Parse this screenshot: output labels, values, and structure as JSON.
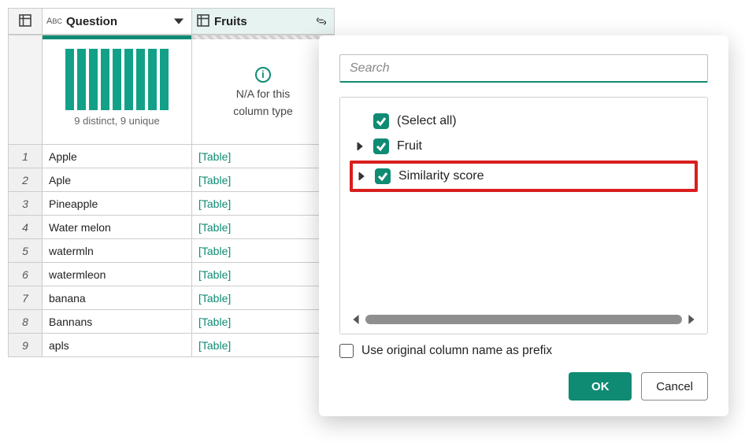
{
  "columns": {
    "question": {
      "label": "Question"
    },
    "fruits": {
      "label": "Fruits"
    }
  },
  "profile": {
    "question_summary": "9 distinct, 9 unique",
    "fruits_na_line1": "N/A for this",
    "fruits_na_line2": "column type"
  },
  "rows": [
    {
      "n": "1",
      "question": "Apple",
      "fruits": "[Table]"
    },
    {
      "n": "2",
      "question": "Aple",
      "fruits": "[Table]"
    },
    {
      "n": "3",
      "question": "Pineapple",
      "fruits": "[Table]"
    },
    {
      "n": "4",
      "question": "Water melon",
      "fruits": "[Table]"
    },
    {
      "n": "5",
      "question": "watermln",
      "fruits": "[Table]"
    },
    {
      "n": "6",
      "question": "watermleon",
      "fruits": "[Table]"
    },
    {
      "n": "7",
      "question": "banana",
      "fruits": "[Table]"
    },
    {
      "n": "8",
      "question": "Bannans",
      "fruits": "[Table]"
    },
    {
      "n": "9",
      "question": "apls",
      "fruits": "[Table]"
    }
  ],
  "panel": {
    "search_placeholder": "Search",
    "options": {
      "all": {
        "label": "(Select all)",
        "checked": true,
        "highlighted": false
      },
      "fruit": {
        "label": "Fruit",
        "checked": true,
        "highlighted": false
      },
      "similarity": {
        "label": "Similarity score",
        "checked": true,
        "highlighted": true
      }
    },
    "prefix_label": "Use original column name as prefix",
    "prefix_checked": false,
    "ok_label": "OK",
    "cancel_label": "Cancel"
  }
}
